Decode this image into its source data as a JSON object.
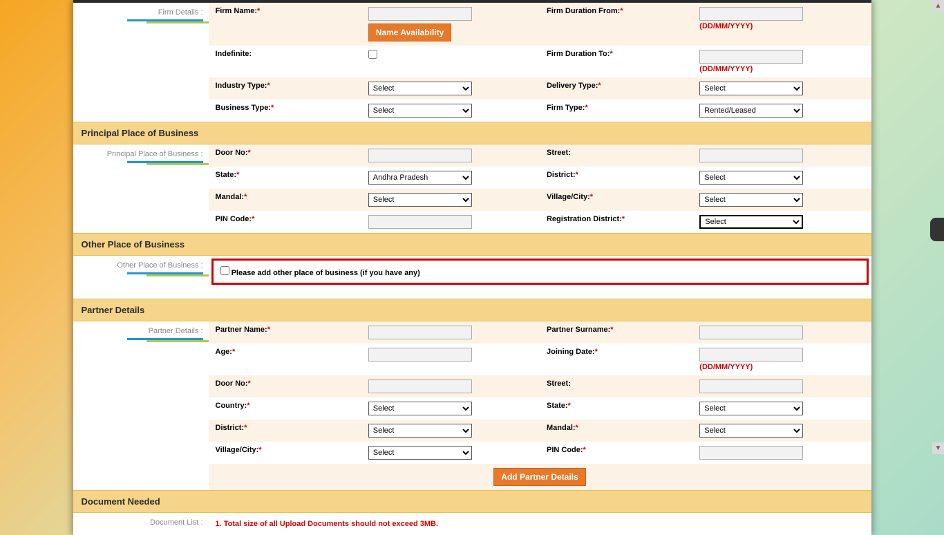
{
  "firmDetails": {
    "sidebarLabel": "Firm Details :",
    "firmNameLabel": "Firm Name:",
    "nameAvailBtn": "Name Availability",
    "durationFromLabel": "Firm Duration From:",
    "dateHint": "(DD/MM/YYYY)",
    "indefiniteLabel": "Indefinite:",
    "durationToLabel": "Firm Duration To:",
    "industryTypeLabel": "Industry Type:",
    "deliveryTypeLabel": "Delivery Type:",
    "businessTypeLabel": "Business Type:",
    "firmTypeLabel": "Firm Type:",
    "selectPlaceholder": "Select",
    "firmTypeValue": "Rented/Leased"
  },
  "principal": {
    "header": "Principal Place of Business",
    "sidebarLabel": "Principal Place of Business :",
    "doorNoLabel": "Door No:",
    "streetLabel": "Street:",
    "stateLabel": "State:",
    "stateValue": "Andhra Pradesh",
    "districtLabel": "District:",
    "mandalLabel": "Mandal:",
    "villageLabel": "Village/City:",
    "pinLabel": "PIN Code:",
    "regDistrictLabel": "Registration District:",
    "selectPlaceholder": "Select"
  },
  "other": {
    "header": "Other Place of Business",
    "sidebarLabel": "Other Place of Business :",
    "checkboxLabel": "Please add other place of business (if you have any)"
  },
  "partner": {
    "header": "Partner Details",
    "sidebarLabel": "Partner Details :",
    "partnerNameLabel": "Partner Name:",
    "partnerSurnameLabel": "Partner Surname:",
    "ageLabel": "Age:",
    "joiningDateLabel": "Joining Date:",
    "dateHint": "(DD/MM/YYYY)",
    "doorNoLabel": "Door No:",
    "streetLabel": "Street:",
    "countryLabel": "Country:",
    "stateLabel": "State:",
    "districtLabel": "District:",
    "mandalLabel": "Mandal:",
    "villageLabel": "Village/City:",
    "pinLabel": "PIN Code:",
    "selectPlaceholder": "Select",
    "addBtn": "Add Partner Details"
  },
  "document": {
    "header": "Document Needed",
    "sidebarLabel": "Document List :",
    "note": "1. Total size of all Upload Documents should not exceed 3MB."
  }
}
